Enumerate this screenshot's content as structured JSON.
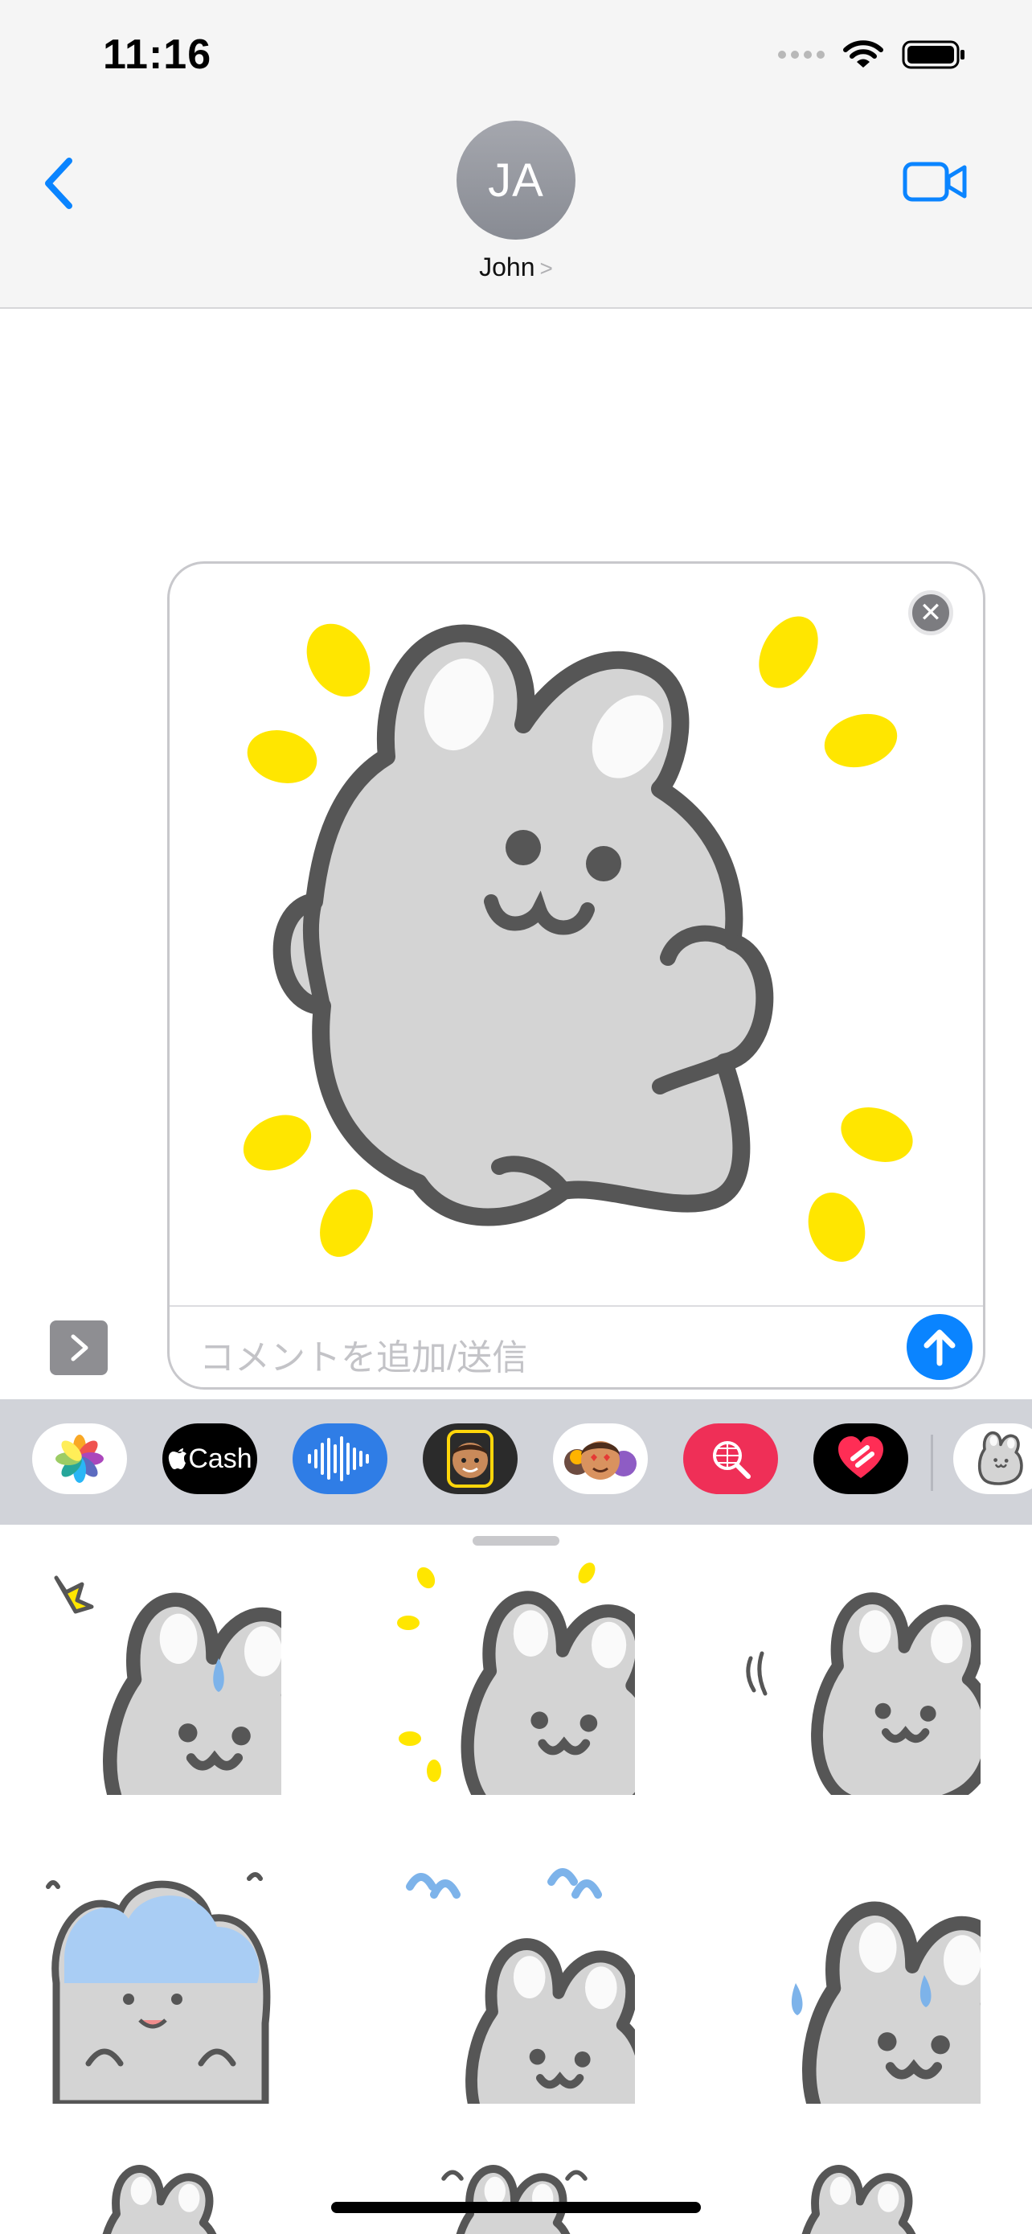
{
  "status_bar": {
    "time": "11:16"
  },
  "header": {
    "avatar_initials": "JA",
    "contact_name": "John",
    "chevron": ">"
  },
  "compose": {
    "comment_placeholder": "コメントを追加/送信"
  },
  "app_drawer": {
    "cash_label": "Cash",
    "apps": [
      "photos",
      "apple-cash",
      "audio-message",
      "memoji",
      "memoji-stickers",
      "image-search",
      "digital-touch",
      "bunny-stickers"
    ]
  },
  "colors": {
    "accent": "#0a84ff",
    "bunny_fill": "#d4d4d4",
    "bunny_stroke": "#565656",
    "spark": "#ffe600",
    "sweat": "#7db3ea"
  }
}
